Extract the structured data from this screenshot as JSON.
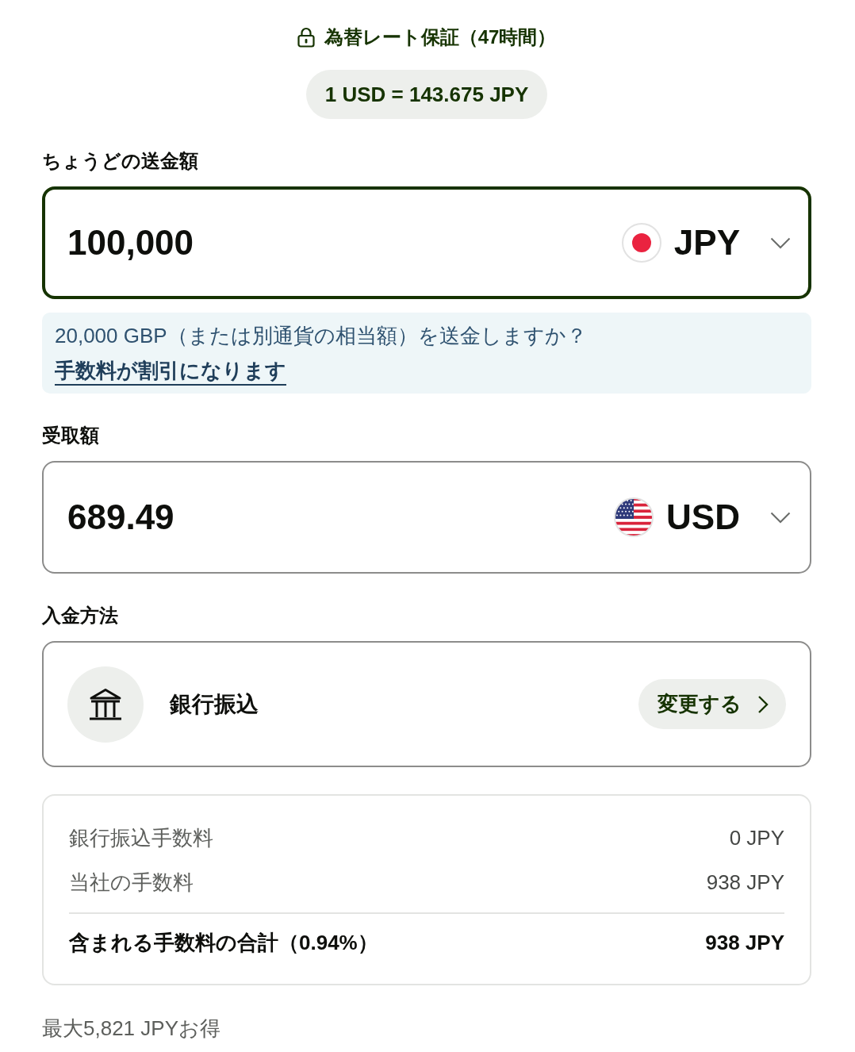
{
  "rate_guarantee": {
    "text": "為替レート保証（47時間）"
  },
  "rate": {
    "text": "1 USD = 143.675 JPY"
  },
  "send_amount": {
    "label": "ちょうどの送金額",
    "value": "100,000",
    "currency": "JPY",
    "focused": true
  },
  "notice": {
    "text": "20,000 GBP（または別通貨の相当額）を送金しますか？",
    "link": "手数料が割引になります"
  },
  "receive_amount": {
    "label": "受取額",
    "value": "689.49",
    "currency": "USD",
    "focused": false
  },
  "payment_method": {
    "label": "入金方法",
    "method": "銀行振込",
    "button": "変更する"
  },
  "fees": {
    "rows": [
      {
        "kind": "item",
        "label": "銀行振込手数料",
        "value": "0 JPY"
      },
      {
        "kind": "item",
        "label": "当社の手数料",
        "value": "938 JPY"
      },
      {
        "kind": "total",
        "label": "含まれる手数料の合計（0.94%）",
        "value": "938 JPY"
      }
    ]
  },
  "savings": {
    "text": "最大5,821 JPYお得"
  }
}
